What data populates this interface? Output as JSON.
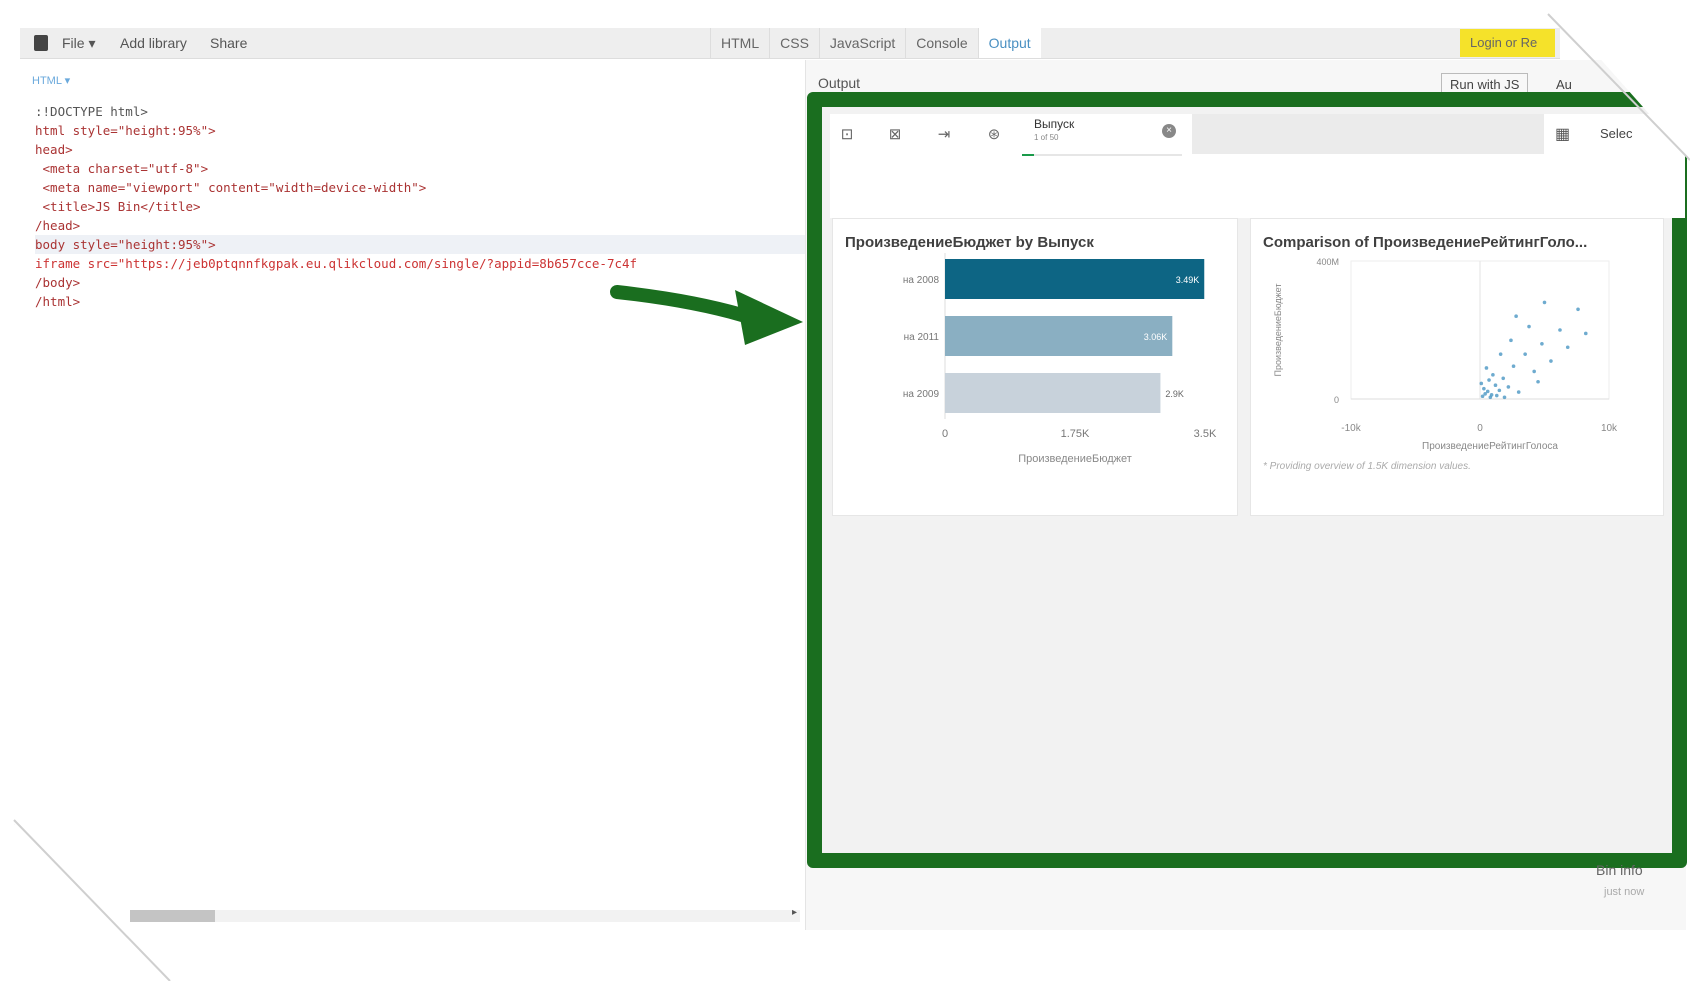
{
  "toolbar": {
    "file": "File ▾",
    "add_library": "Add library",
    "share": "Share",
    "tabs": [
      "HTML",
      "CSS",
      "JavaScript",
      "Console",
      "Output"
    ],
    "login": "Login or Re"
  },
  "editor": {
    "label": "HTML ▾",
    "lines": [
      ":!DOCTYPE html>",
      "html style=\"height:95%\">",
      "head>",
      " <meta charset=\"utf-8\">",
      " <meta name=\"viewport\" content=\"width=device-width\">",
      " <title>JS Bin</title>",
      "/head>",
      "body style=\"height:95%\">",
      "iframe src=\"https://jeb0ptqnnfkgpak.eu.qlikcloud.com/single/?appid=8b657cce-7c4f",
      "/body>",
      "/html>"
    ]
  },
  "output": {
    "label": "Output",
    "run_button": "Run with JS",
    "auto_label": "Au",
    "bin_info": "Bin info",
    "bin_time": "just now"
  },
  "qlik": {
    "selection_title": "Выпуск",
    "selection_sub": "1 of 50",
    "select_label": "Selec",
    "colors": {
      "bar_dark": "#0d6584",
      "bar_mid": "#8aafc2",
      "bar_light": "#c8d2db",
      "green_frame": "#1a6e1f",
      "scatter": "#3e8fbf"
    }
  },
  "chart_data": [
    {
      "type": "bar",
      "orientation": "horizontal",
      "title": "ПроизведениеБюджет by Выпуск",
      "categories": [
        "на 2008",
        "на 2011",
        "на 2009"
      ],
      "values": [
        3490,
        3060,
        2900
      ],
      "value_labels": [
        "3.49K",
        "3.06K",
        "2.9K"
      ],
      "xlabel": "ПроизведениеБюджет",
      "ylabel": "",
      "xlim": [
        0,
        3500
      ],
      "x_ticks": [
        "0",
        "1.75K",
        "3.5K"
      ]
    },
    {
      "type": "scatter",
      "title": "Comparison of ПроизведениеРейтингГоло...",
      "xlabel": "ПроизведениеРейтингГолоса",
      "ylabel": "ПроизведениеБюджет",
      "x_ticks": [
        "-10k",
        "0",
        "10k"
      ],
      "y_ticks": [
        "400M",
        "0"
      ],
      "xlim": [
        -10000,
        10000
      ],
      "ylim": [
        0,
        400000000
      ],
      "note": "* Providing overview of 1.5K dimension values.",
      "points": [
        {
          "x": 200,
          "y": 8000000
        },
        {
          "x": 400,
          "y": 15000000
        },
        {
          "x": 600,
          "y": 22000000
        },
        {
          "x": 300,
          "y": 30000000
        },
        {
          "x": 900,
          "y": 12000000
        },
        {
          "x": 1200,
          "y": 40000000
        },
        {
          "x": 700,
          "y": 55000000
        },
        {
          "x": 1500,
          "y": 25000000
        },
        {
          "x": 100,
          "y": 45000000
        },
        {
          "x": 1000,
          "y": 70000000
        },
        {
          "x": 1800,
          "y": 60000000
        },
        {
          "x": 2200,
          "y": 35000000
        },
        {
          "x": 2600,
          "y": 95000000
        },
        {
          "x": 3000,
          "y": 20000000
        },
        {
          "x": 3500,
          "y": 130000000
        },
        {
          "x": 4200,
          "y": 80000000
        },
        {
          "x": 4800,
          "y": 160000000
        },
        {
          "x": 5500,
          "y": 110000000
        },
        {
          "x": 6200,
          "y": 200000000
        },
        {
          "x": 6800,
          "y": 150000000
        },
        {
          "x": 7600,
          "y": 260000000
        },
        {
          "x": 8200,
          "y": 190000000
        },
        {
          "x": 2800,
          "y": 240000000
        },
        {
          "x": 3800,
          "y": 210000000
        },
        {
          "x": 5000,
          "y": 280000000
        },
        {
          "x": 1600,
          "y": 130000000
        },
        {
          "x": 2400,
          "y": 170000000
        },
        {
          "x": 4500,
          "y": 50000000
        },
        {
          "x": 500,
          "y": 90000000
        },
        {
          "x": 800,
          "y": 5000000
        },
        {
          "x": 1300,
          "y": 10000000
        },
        {
          "x": 1900,
          "y": 5000000
        }
      ]
    }
  ]
}
